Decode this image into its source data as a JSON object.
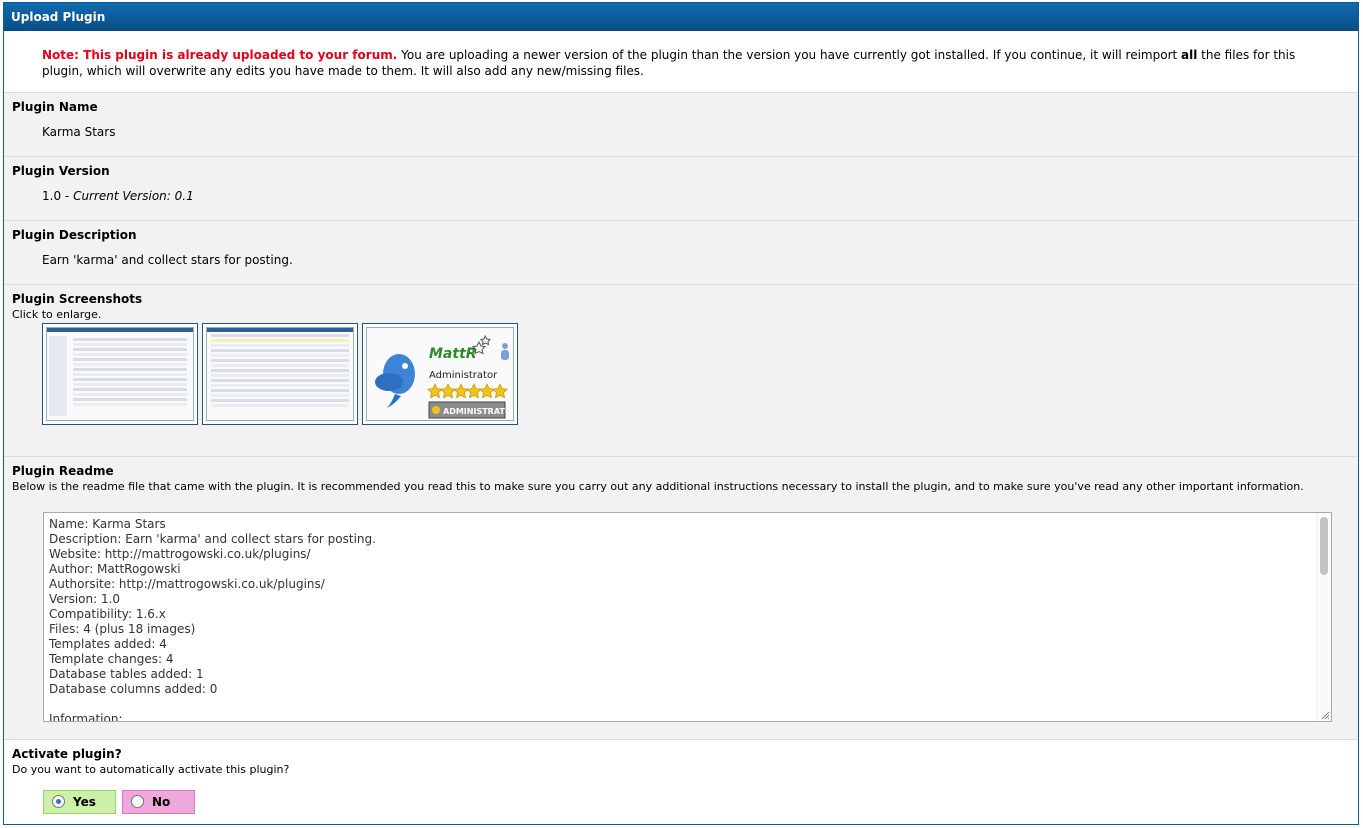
{
  "header": {
    "title": "Upload Plugin"
  },
  "note": {
    "warning": "Note: This plugin is already uploaded to your forum.",
    "text_a": " You are uploading a newer version of the plugin than the version you have currently got installed. If you continue, it will reimport ",
    "text_bold": "all",
    "text_b": " the files for this plugin, which will overwrite any edits you have made to them. It will also add any new/missing files."
  },
  "plugin_name": {
    "label": "Plugin Name",
    "value": "Karma Stars"
  },
  "plugin_version": {
    "label": "Plugin Version",
    "value": "1.0",
    "sep": " - ",
    "current": "Current Version: 0.1"
  },
  "plugin_description": {
    "label": "Plugin Description",
    "value": "Earn 'karma' and collect stars for posting."
  },
  "screenshots": {
    "label": "Plugin Screenshots",
    "hint": "Click to enlarge.",
    "card": {
      "name": "MattR",
      "role": "Administrator",
      "badge": "ADMINISTRATOR"
    }
  },
  "readme": {
    "label": "Plugin Readme",
    "description": "Below is the readme file that came with the plugin. It is recommended you read this to make sure you carry out any additional instructions necessary to install the plugin, and to make sure you've read any other important information.",
    "lines": [
      "Name: Karma Stars",
      "Description: Earn 'karma' and collect stars for posting.",
      "Website: http://mattrogowski.co.uk/plugins/",
      "Author: MattRogowski",
      "Authorsite: http://mattrogowski.co.uk/plugins/",
      "Version: 1.0",
      "Compatibility: 1.6.x",
      "Files: 4 (plus 18 images)",
      "Templates added: 4",
      "Template changes: 4",
      "Database tables added: 1",
      "Database columns added: 0",
      "",
      "Information:"
    ]
  },
  "activate": {
    "label": "Activate plugin?",
    "description": "Do you want to automatically activate this plugin?",
    "yes": "Yes",
    "no": "No",
    "selected": "yes"
  },
  "colors": {
    "header_bg": "#0a5a9c",
    "warning": "#e3001b",
    "yes_bg": "#ccf0a8",
    "no_bg": "#efa8de"
  }
}
